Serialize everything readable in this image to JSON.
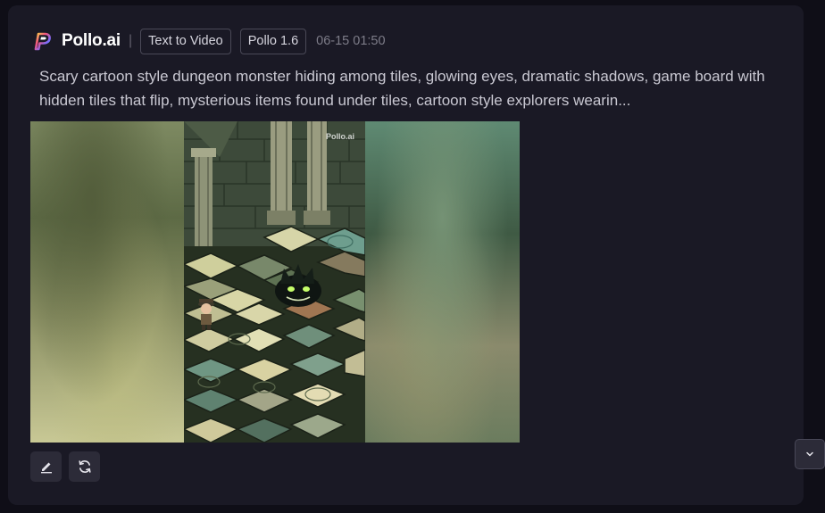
{
  "header": {
    "brand": "Pollo.ai",
    "separator": "|",
    "mode_chip": "Text to Video",
    "model_chip": "Pollo 1.6",
    "timestamp": "06-15 01:50"
  },
  "prompt": {
    "text": "Scary cartoon style dungeon monster hiding among tiles, glowing eyes, dramatic shadows, game board with hidden tiles that flip, mysterious items found under tiles, cartoon style explorers wearin..."
  },
  "media": {
    "watermark": "Pollo.ai"
  },
  "icons": {
    "logo": "pollo-logo-icon",
    "edit": "pencil-icon",
    "regenerate": "refresh-icon",
    "scroll": "chevron-down-icon"
  },
  "colors": {
    "background": "#0f0e17",
    "card": "#1a1925",
    "button": "#2c2b38",
    "text_primary": "#ffffff",
    "text_secondary": "#c9c8d2",
    "text_muted": "#7d7c88"
  }
}
